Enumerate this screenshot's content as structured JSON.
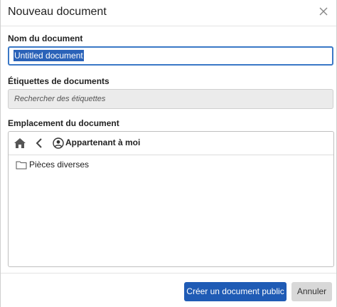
{
  "dialog": {
    "title": "Nouveau document",
    "close_icon": "close-icon"
  },
  "name_field": {
    "label": "Nom du document",
    "value": "Untitled document"
  },
  "tags_field": {
    "label": "Étiquettes de documents",
    "placeholder": "Rechercher des étiquettes"
  },
  "location": {
    "label": "Emplacement du document",
    "toolbar": {
      "home_icon": "home-icon",
      "back_icon": "chevron-left-icon",
      "owner_icon": "user-circle-icon",
      "owner_label": "Appartenant à moi"
    },
    "folders": [
      {
        "icon": "folder-icon",
        "label": "Pièces diverses"
      }
    ]
  },
  "footer": {
    "primary_label": "Créer un document public",
    "secondary_label": "Annuler"
  },
  "colors": {
    "primary": "#1f5bb5",
    "input_focus": "#3a78c6",
    "selection": "#2a62b8"
  }
}
